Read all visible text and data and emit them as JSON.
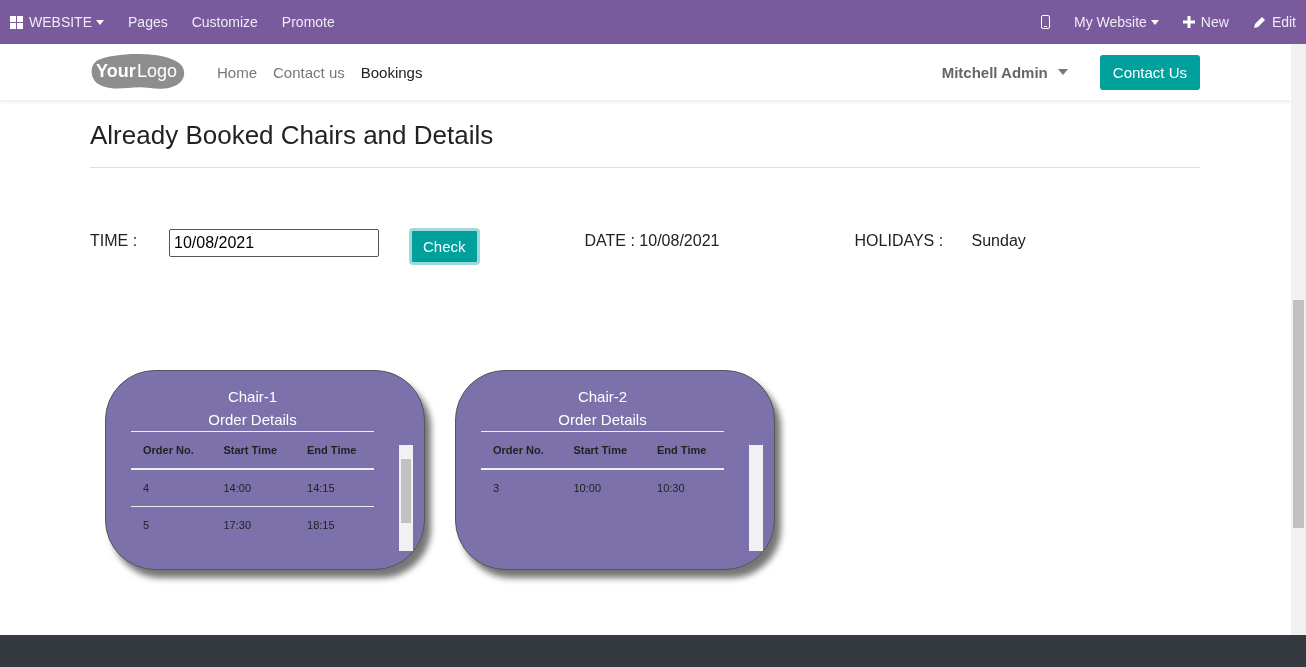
{
  "admin_bar": {
    "app_menu": "WEBSITE",
    "items": [
      "Pages",
      "Customize",
      "Promote"
    ],
    "website_menu": "My Website",
    "new": "New",
    "edit": "Edit"
  },
  "header": {
    "logo": [
      "Your",
      "Logo"
    ],
    "nav": [
      {
        "label": "Home",
        "selected": false
      },
      {
        "label": "Contact us",
        "selected": false
      },
      {
        "label": "Bookings",
        "selected": true
      }
    ],
    "user": "Mitchell Admin",
    "cta": "Contact Us"
  },
  "page_title": "Already Booked Chairs and Details",
  "filter": {
    "time_label": "TIME :",
    "time_value": "10/08/2021",
    "check": "Check",
    "date": "DATE : 10/08/2021",
    "holidays_label": "HOLIDAYS :",
    "holidays_value": "Sunday"
  },
  "chairs": [
    {
      "name": "Chair-1",
      "subtitle": "Order Details",
      "columns": [
        "Order No.",
        "Start Time",
        "End Time"
      ],
      "rows": [
        [
          "4",
          "14:00",
          "14:15"
        ],
        [
          "5",
          "17:30",
          "18:15"
        ]
      ]
    },
    {
      "name": "Chair-2",
      "subtitle": "Order Details",
      "columns": [
        "Order No.",
        "Start Time",
        "End Time"
      ],
      "rows": [
        [
          "3",
          "10:00",
          "10:30"
        ]
      ]
    }
  ]
}
